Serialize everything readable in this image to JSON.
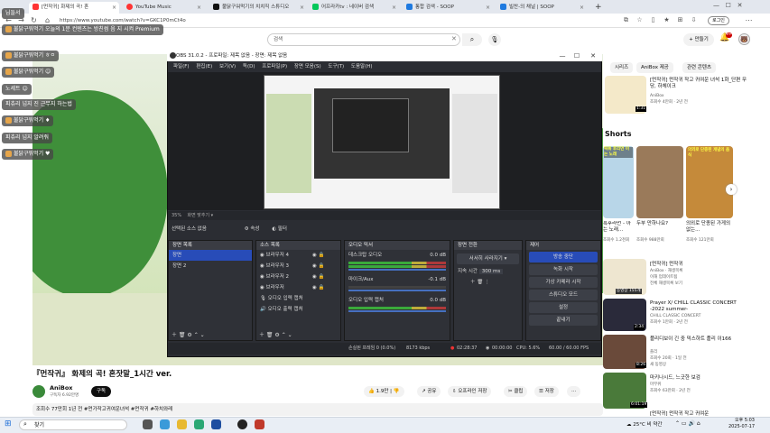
{
  "browser": {
    "tabs": [
      {
        "label": "[먼작귀] 화제의 곡! 혼"
      },
      {
        "label": "YouTube Music"
      },
      {
        "label": "불닭구워먹기의 치치직 스튜디오"
      },
      {
        "label": "어프라카tv : 네이버 검색"
      },
      {
        "label": "통합 검색 - SOOP"
      },
      {
        "label": "빌찬-의 채널 | SOOP"
      }
    ],
    "new_tab": "+",
    "url": "https://www.youtube.com/watch?v=GKC1P0mCt4o",
    "profile_label": "로그인"
  },
  "youtube": {
    "search_placeholder": "검색",
    "create_label": "+ 만들기",
    "notif_count": "9+",
    "chips": [
      "시리즈",
      "AniBox 제공",
      "관련 콘텐츠"
    ],
    "top_rec": {
      "title": "[먼작귀] 먼작귀 작고 귀여운 녀석 1화_단편 무당, 하체이크",
      "channel": "AniBox",
      "meta": "조회수 4만회 · 2년 전",
      "duration": "1:31"
    },
    "shorts_title": "Shorts",
    "shorts": [
      {
        "title": "흑후라먼 - 아는 노래...",
        "views": "조회수 1.2천회",
        "label": "떡볶 후리먼 이는 노래"
      },
      {
        "title": "두부 만하나요?",
        "views": "조회수 988만회"
      },
      {
        "title": "의외로 단종된 가게의 없는...",
        "views": "조회수 121만회",
        "label": "의외로 단종된 개념의 음식"
      }
    ],
    "recs": [
      {
        "title": "[먼작귀] 먼작귀",
        "channel": "AniBox · 재생목록",
        "meta": "이해 업데이트됨",
        "extra": "전체 재생목록 보기",
        "badge": "동영상 155개"
      },
      {
        "title": "Prayer X/ CHILL CLASSIC CONCERT -2022 summer-",
        "channel": "CHILL CLASSIC CONCERT",
        "meta": "조회수 1만회 · 2년 전",
        "duration": "2:34"
      },
      {
        "title": "플리디보이 긴 중 믹스하트 플리 이166",
        "channel": "플리",
        "meta": "조회수 20회 · 1일 전",
        "extra": "새 동영상",
        "duration": "8:26"
      },
      {
        "title": "마키나시드, 느긋한 보검",
        "channel": "마무위",
        "meta": "조회수 63만회 · 2년 전",
        "duration": "6:01:19"
      },
      {
        "title": "[먼작귀] 먼작귀 작고 귀여운",
        "channel": "",
        "meta": "",
        "duration": ""
      }
    ]
  },
  "video": {
    "title": "『먼작귀』 화제의 곡! 혼잣말_1시간 ver.",
    "channel": "AniBox",
    "subs": "구독자 6.92만명",
    "subscribe": "구독",
    "likes": "1.9만",
    "share": "공유",
    "offline": "오프라인 저장",
    "clip": "클립",
    "save": "저장",
    "more": "···",
    "desc": "조회수 77만회  1년 전  #먼가작고귀여운녀석 #먼작귀 #하치와레"
  },
  "chat": [
    {
      "name": "",
      "text": "님들서"
    },
    {
      "name": "불닭구워먹기",
      "text": "오늘의 1분 컨텐츠는 방친썸 음 지 시켜 Premium"
    },
    {
      "name": "불닭구워먹기",
      "text": "ㅎㅇ"
    },
    {
      "name": "불닭구워먹기",
      "text": ""
    },
    {
      "name": "",
      "text": "노세트"
    },
    {
      "name": "",
      "text": "피츄리 넘지 진 근무지 하는법"
    },
    {
      "name": "불닭구워먹기",
      "text": ""
    },
    {
      "name": "",
      "text": "피츄리 넘지 알려줘"
    },
    {
      "name": "불닭구워먹기",
      "text": ""
    }
  ],
  "obs": {
    "title": "OBS 31.0.2 - 프로파일: 제목 없음 - 장면: 제목 없음",
    "menu": [
      "파일(F)",
      "편집(E)",
      "보기(V)",
      "독(D)",
      "프로파일(P)",
      "장면 모음(S)",
      "도구(T)",
      "도움말(H)"
    ],
    "zoom": "35%",
    "zoom_label": "화면 맞추기",
    "no_source": "선택된 소스 없음",
    "properties": "속성",
    "filters": "필터",
    "docks": {
      "scenes": {
        "title": "장면 목록",
        "items": [
          "장면",
          "장면 2"
        ]
      },
      "sources": {
        "title": "소스 목록",
        "items": [
          "브라우저 4",
          "브라우저 3",
          "브라우저 2",
          "브라우저",
          "오디오 입력 캡처",
          "오디오 출력 캡처"
        ]
      },
      "audio": {
        "title": "오디오 믹서",
        "channels": [
          {
            "name": "데스크탑 오디오",
            "db": "0.0 dB"
          },
          {
            "name": "마이크/Aux",
            "db": "-0.1 dB"
          },
          {
            "name": "오디오 입력 캡처",
            "db": "0.0 dB"
          }
        ]
      },
      "transitions": {
        "title": "장면 전환",
        "type": "서서히 사라지기",
        "duration_label": "지속 시간",
        "duration": "300 ms"
      },
      "controls": {
        "title": "제어",
        "buttons": [
          "방송 중단",
          "녹화 시작",
          "가상 카메라 시작",
          "스튜디오 모드",
          "설정",
          "끝내기"
        ]
      }
    },
    "status": {
      "dropped": "손실된 프레임 0 (0.0%)",
      "bitrate": "8173 kbps",
      "live_time": "02:28:37",
      "rec_time": "00:00:00",
      "cpu": "CPU: 5.6%",
      "fps": "60.00 / 60.00 FPS"
    }
  },
  "taskbar": {
    "search": "찾기",
    "weather": "25°C 비 약간",
    "time": "오후 5:03",
    "date": "2025-07-17"
  },
  "colors": {
    "youtube_red": "#cc0000",
    "obs_bg": "#2b2d33",
    "obs_accent": "#284cb8",
    "chat_bg": "#464646"
  }
}
